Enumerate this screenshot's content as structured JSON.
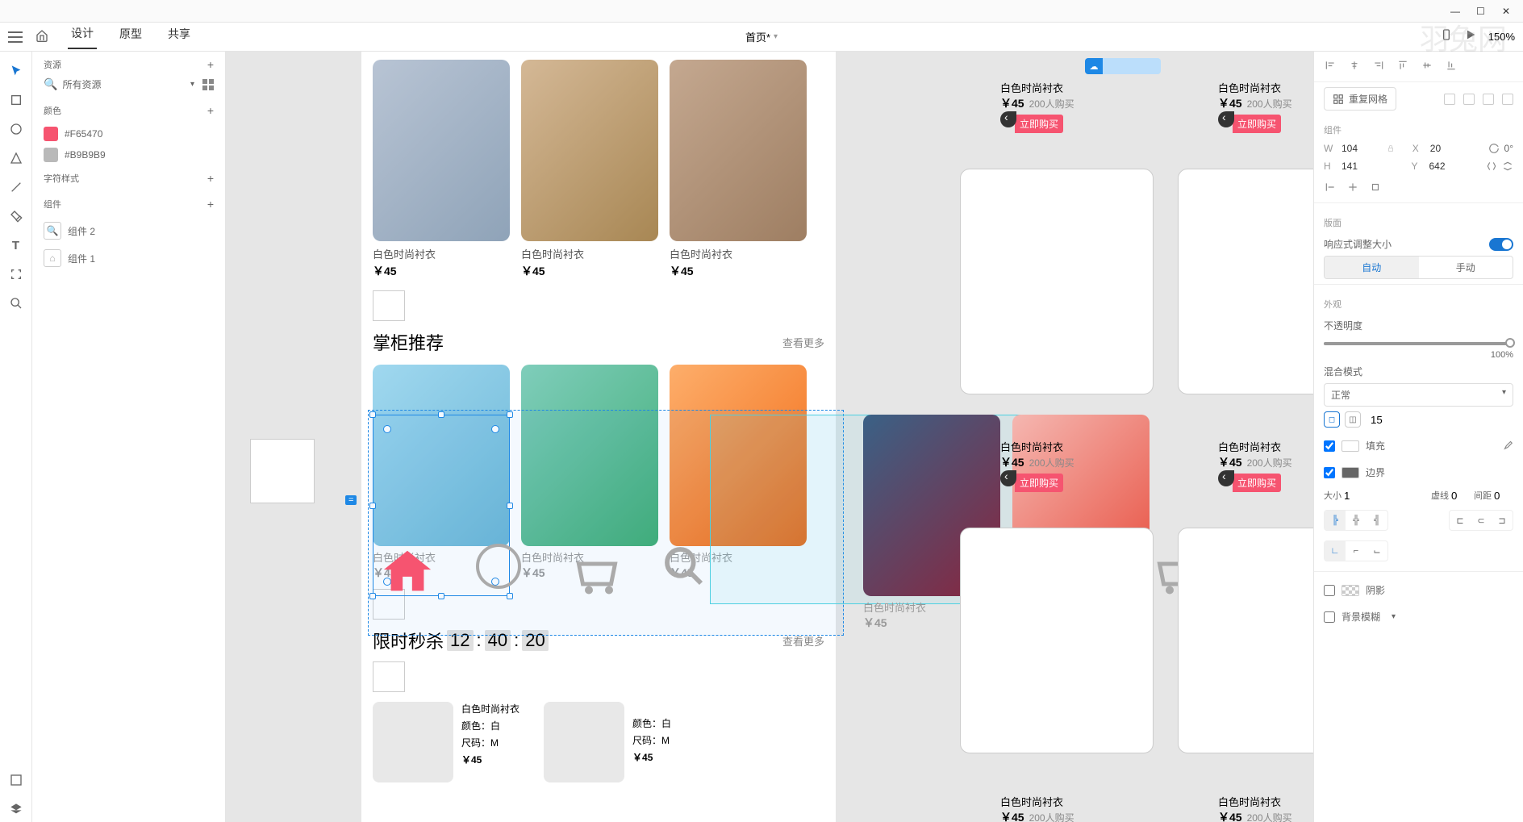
{
  "titlebar": {
    "min": "—",
    "max": "☐",
    "close": "✕"
  },
  "topbar": {
    "tabs": {
      "design": "设计",
      "proto": "原型",
      "share": "共享"
    },
    "doc": "首页*",
    "zoom": "150%"
  },
  "leftpanel": {
    "assets": "资源",
    "search_sel": "所有资源",
    "colors": "颜色",
    "sw1": "#F65470",
    "sw2": "#B9B9B9",
    "char": "字符样式",
    "comps": "组件",
    "comp1": "组件 2",
    "comp2": "组件 1"
  },
  "rightpanel": {
    "repeat": "重复网格",
    "comps_lbl": "组件",
    "w": "104",
    "x": "20",
    "h": "141",
    "y": "642",
    "rot": "0°",
    "layout": "版面",
    "responsive": "响应式调整大小",
    "auto": "自动",
    "manual": "手动",
    "appearance": "外观",
    "opacity_lbl": "不透明度",
    "opacity_val": "100%",
    "blend_lbl": "混合模式",
    "blend_val": "正常",
    "radius": "15",
    "fill": "填充",
    "border": "边界",
    "size_lbl": "大小",
    "size_val": "1",
    "dash_lbl": "虚线",
    "dash_val": "0",
    "gap_lbl": "间距",
    "gap_val": "0",
    "shadow": "阴影",
    "bgblur": "背景模糊"
  },
  "canvas": {
    "product_name": "白色时尚衬衣",
    "price": "￥45",
    "buyers": "200人购买",
    "buy_now": "立即购买",
    "rec_title": "掌柜推荐",
    "more": "查看更多",
    "flash_title": "限时秒杀",
    "cd_h": "12",
    "cd_m": "40",
    "cd_s": "20",
    "color_lbl": "颜色：白",
    "size_lbl": "尺码：M"
  }
}
